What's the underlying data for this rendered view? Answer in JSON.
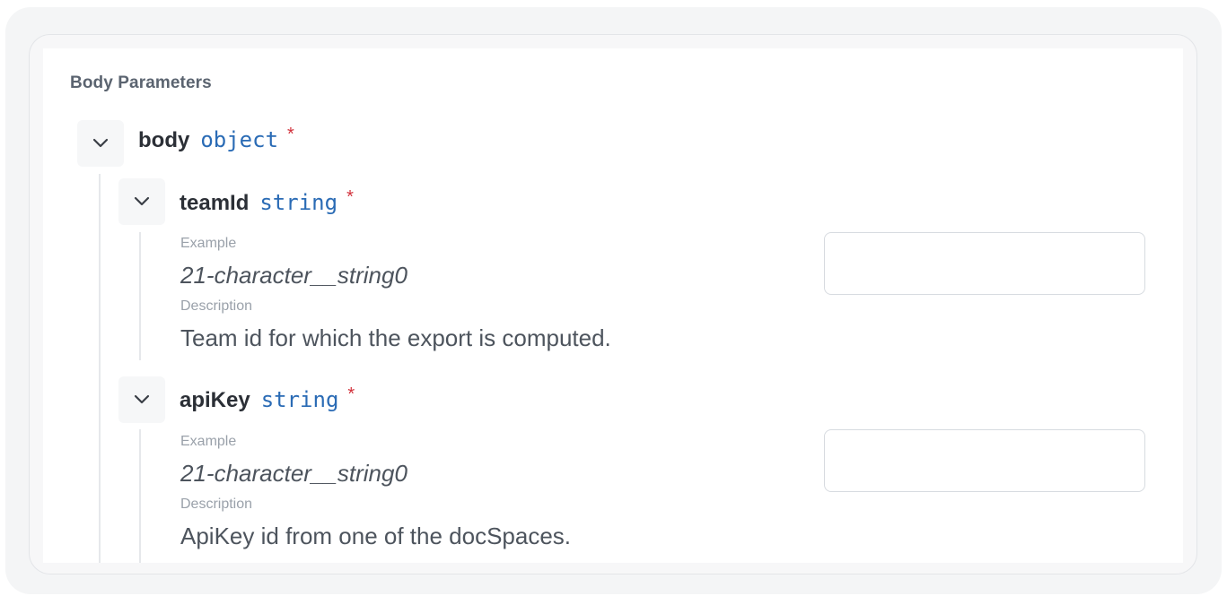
{
  "section": {
    "title": "Body Parameters"
  },
  "body_param": {
    "name": "body",
    "type": "object",
    "required_mark": "*"
  },
  "params": [
    {
      "name": "teamId",
      "type": "string",
      "required_mark": "*",
      "example_label": "Example",
      "example_value": "21-character__string0",
      "description_label": "Description",
      "description_value": "Team id for which the export is computed.",
      "input_value": "",
      "input_placeholder": ""
    },
    {
      "name": "apiKey",
      "type": "string",
      "required_mark": "*",
      "example_label": "Example",
      "example_value": "21-character__string0",
      "description_label": "Description",
      "description_value": "ApiKey id from one of the docSpaces.",
      "input_value": "",
      "input_placeholder": ""
    }
  ],
  "colors": {
    "type_color": "#2a6bb5",
    "required_color": "#d2323c",
    "heading_color": "#5b6470"
  },
  "icons": {
    "toggle": "chevron-down-icon"
  }
}
